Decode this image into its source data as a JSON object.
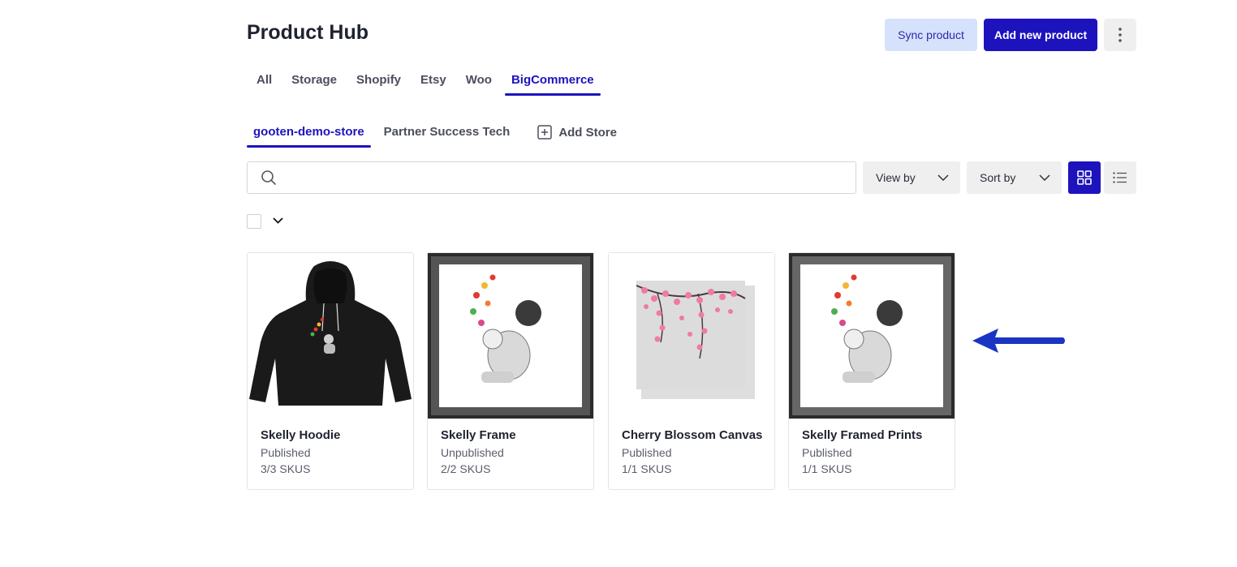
{
  "header": {
    "title": "Product Hub",
    "sync_label": "Sync product",
    "add_label": "Add new product"
  },
  "tabs": [
    {
      "label": "All"
    },
    {
      "label": "Storage"
    },
    {
      "label": "Shopify"
    },
    {
      "label": "Etsy"
    },
    {
      "label": "Woo"
    },
    {
      "label": "BigCommerce",
      "active": true
    }
  ],
  "stores": {
    "items": [
      {
        "label": "gooten-demo-store",
        "active": true
      },
      {
        "label": "Partner Success Tech"
      }
    ],
    "add_label": "Add Store"
  },
  "toolbar": {
    "search_placeholder": "",
    "view_by_label": "View by",
    "sort_by_label": "Sort by",
    "layout": "grid"
  },
  "products": [
    {
      "name": "Skelly Hoodie",
      "status": "Published",
      "skus": "3/3 SKUS",
      "thumb": "hoodie"
    },
    {
      "name": "Skelly Frame",
      "status": "Unpublished",
      "skus": "2/2 SKUS",
      "thumb": "frame"
    },
    {
      "name": "Cherry Blossom Canvas",
      "status": "Published",
      "skus": "1/1 SKUS",
      "thumb": "canvas"
    },
    {
      "name": "Skelly Framed Prints",
      "status": "Published",
      "skus": "1/1 SKUS",
      "thumb": "frame"
    }
  ],
  "colors": {
    "accent": "#1d13bd",
    "sync_bg": "#d6e2fb",
    "arrow": "#1a35c4"
  }
}
